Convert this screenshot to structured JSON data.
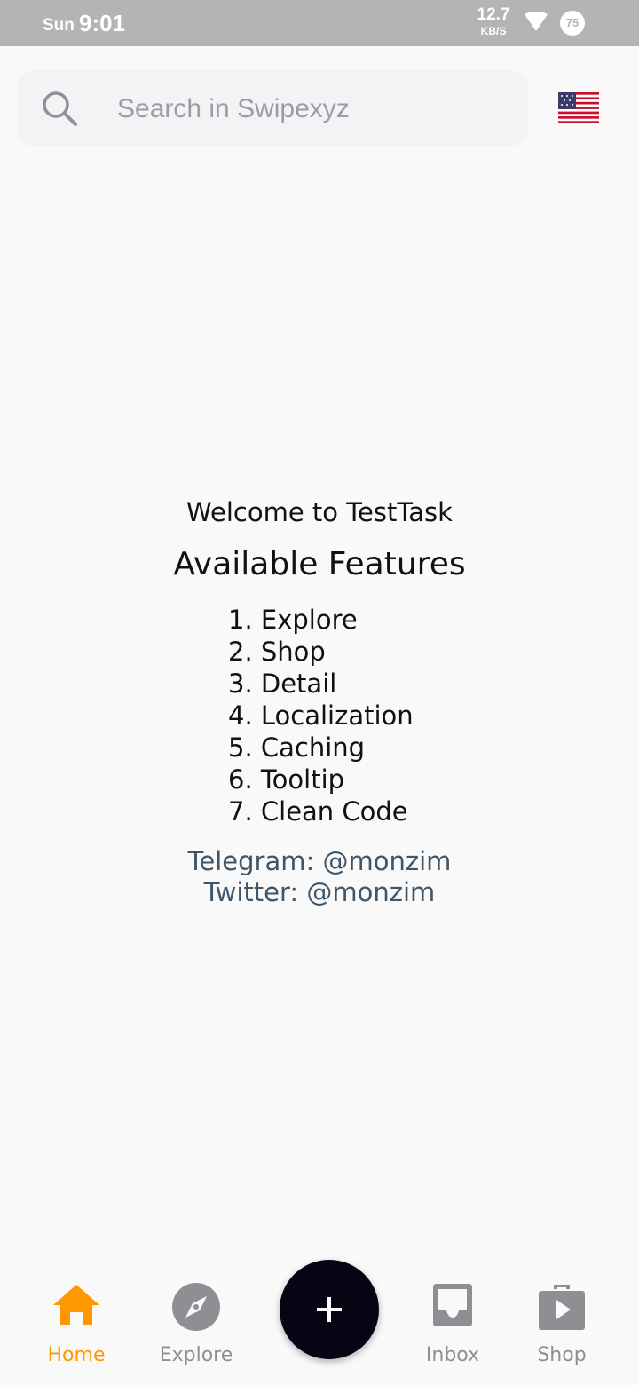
{
  "status_bar": {
    "day": "Sun",
    "time": "9:01",
    "net_speed_value": "12.7",
    "net_speed_unit": "KB/S",
    "battery_level": "75"
  },
  "search": {
    "placeholder": "Search in Swipexyz",
    "icon": "search-icon"
  },
  "language_flag": "us-flag-icon",
  "main": {
    "welcome": "Welcome to TestTask",
    "features_title": "Available Features",
    "features": [
      "1. Explore",
      "2. Shop",
      "3. Detail",
      "4. Localization",
      "5. Caching",
      "6. Tooltip",
      "7. Clean Code"
    ],
    "telegram": "Telegram: @monzim",
    "twitter": "Twitter: @monzim"
  },
  "bottom_nav": {
    "active_color": "#ff9800",
    "inactive_color": "#8e8e93",
    "items": [
      {
        "label": "Home",
        "icon": "home-icon",
        "active": true
      },
      {
        "label": "Explore",
        "icon": "compass-icon",
        "active": false
      },
      {
        "label": "Inbox",
        "icon": "inbox-icon",
        "active": false
      },
      {
        "label": "Shop",
        "icon": "shop-icon",
        "active": false
      }
    ],
    "fab_icon": "plus-icon"
  }
}
